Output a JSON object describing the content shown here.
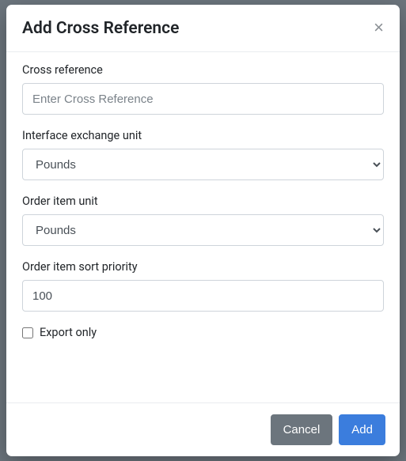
{
  "modal": {
    "title": "Add Cross Reference",
    "close_symbol": "×"
  },
  "form": {
    "cross_reference": {
      "label": "Cross reference",
      "placeholder": "Enter Cross Reference",
      "value": ""
    },
    "interface_unit": {
      "label": "Interface exchange unit",
      "selected": "Pounds"
    },
    "order_unit": {
      "label": "Order item unit",
      "selected": "Pounds"
    },
    "sort_priority": {
      "label": "Order item sort priority",
      "value": "100"
    },
    "export_only": {
      "label": "Export only",
      "checked": false
    }
  },
  "footer": {
    "cancel": "Cancel",
    "add": "Add"
  }
}
